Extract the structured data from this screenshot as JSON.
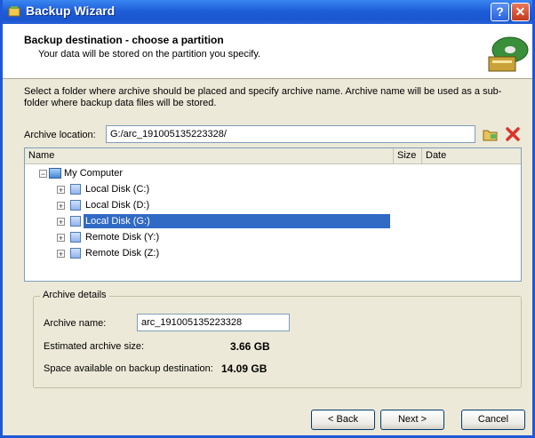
{
  "window": {
    "title": "Backup Wizard",
    "help_label": "?",
    "close_label": "✕"
  },
  "header": {
    "title": "Backup destination - choose a partition",
    "subtitle": "Your data will be stored on the partition you specify."
  },
  "instruction": "Select a folder where archive should be placed and specify archive name. Archive name will be used as a sub-folder where backup data files will be stored.",
  "location": {
    "label": "Archive location:",
    "value": "G:/arc_191005135223328/"
  },
  "tree": {
    "columns": [
      "Name",
      "Size",
      "Date"
    ],
    "root": "My Computer",
    "items": [
      "Local Disk (C:)",
      "Local Disk (D:)",
      "Local Disk (G:)",
      "Remote Disk (Y:)",
      "Remote Disk (Z:)"
    ],
    "selected_index": 2
  },
  "details": {
    "group_label": "Archive details",
    "name_label": "Archive name:",
    "name_value": "arc_191005135223328",
    "size_label": "Estimated archive size:",
    "size_value": "3.66 GB",
    "space_label": "Space available on backup destination:",
    "space_value": "14.09 GB"
  },
  "buttons": {
    "back": "< Back",
    "next": "Next >",
    "cancel": "Cancel"
  },
  "colors": {
    "titlebar": "#1e5fd9",
    "selection": "#316ac5",
    "dialog_bg": "#ece9d8"
  }
}
